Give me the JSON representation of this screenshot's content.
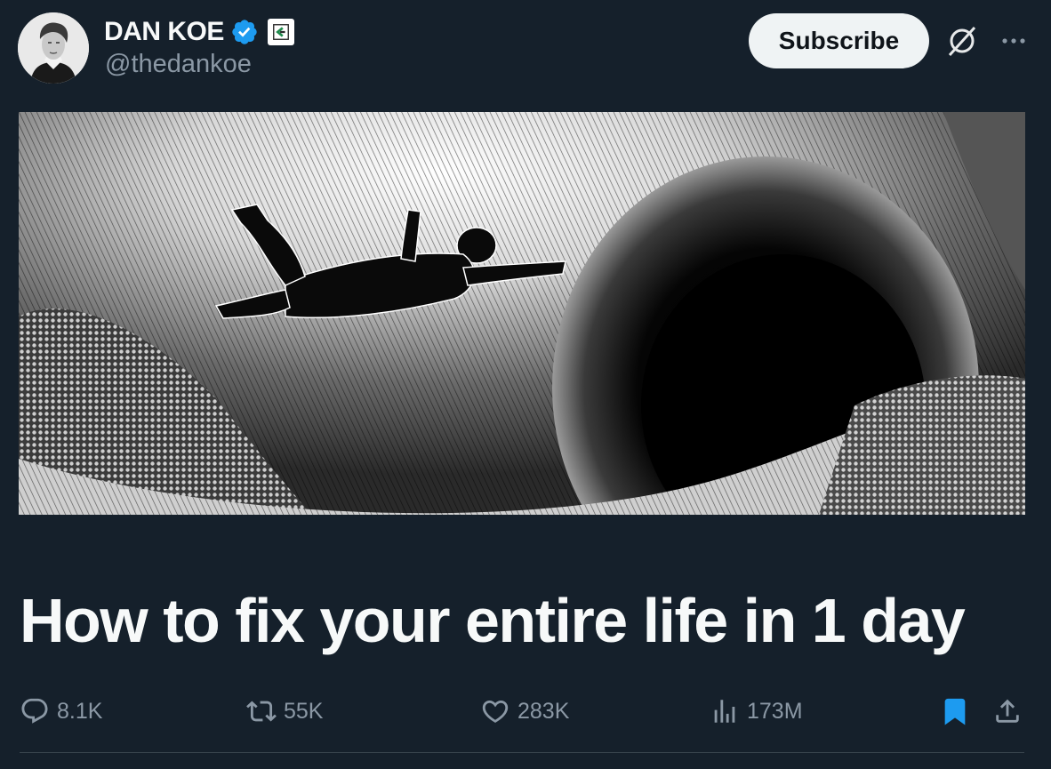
{
  "author": {
    "display_name": "DAN KOE",
    "handle": "@thedankoe",
    "verified": true
  },
  "header": {
    "subscribe_label": "Subscribe",
    "grok_icon": "grok-icon",
    "more_icon": "more-icon"
  },
  "article": {
    "title": "How to fix your entire life in 1 day",
    "cover_description_icon": "article-cover-image"
  },
  "actions": {
    "replies": "8.1K",
    "reposts": "55K",
    "likes": "283K",
    "views": "173M",
    "bookmarked": true
  },
  "colors": {
    "background": "#15202b",
    "text_primary": "#f7f9f9",
    "text_secondary": "#8b98a5",
    "verified_blue": "#1d9bf0",
    "bookmark_blue": "#1d9bf0",
    "subscribe_bg": "#eff3f4"
  }
}
